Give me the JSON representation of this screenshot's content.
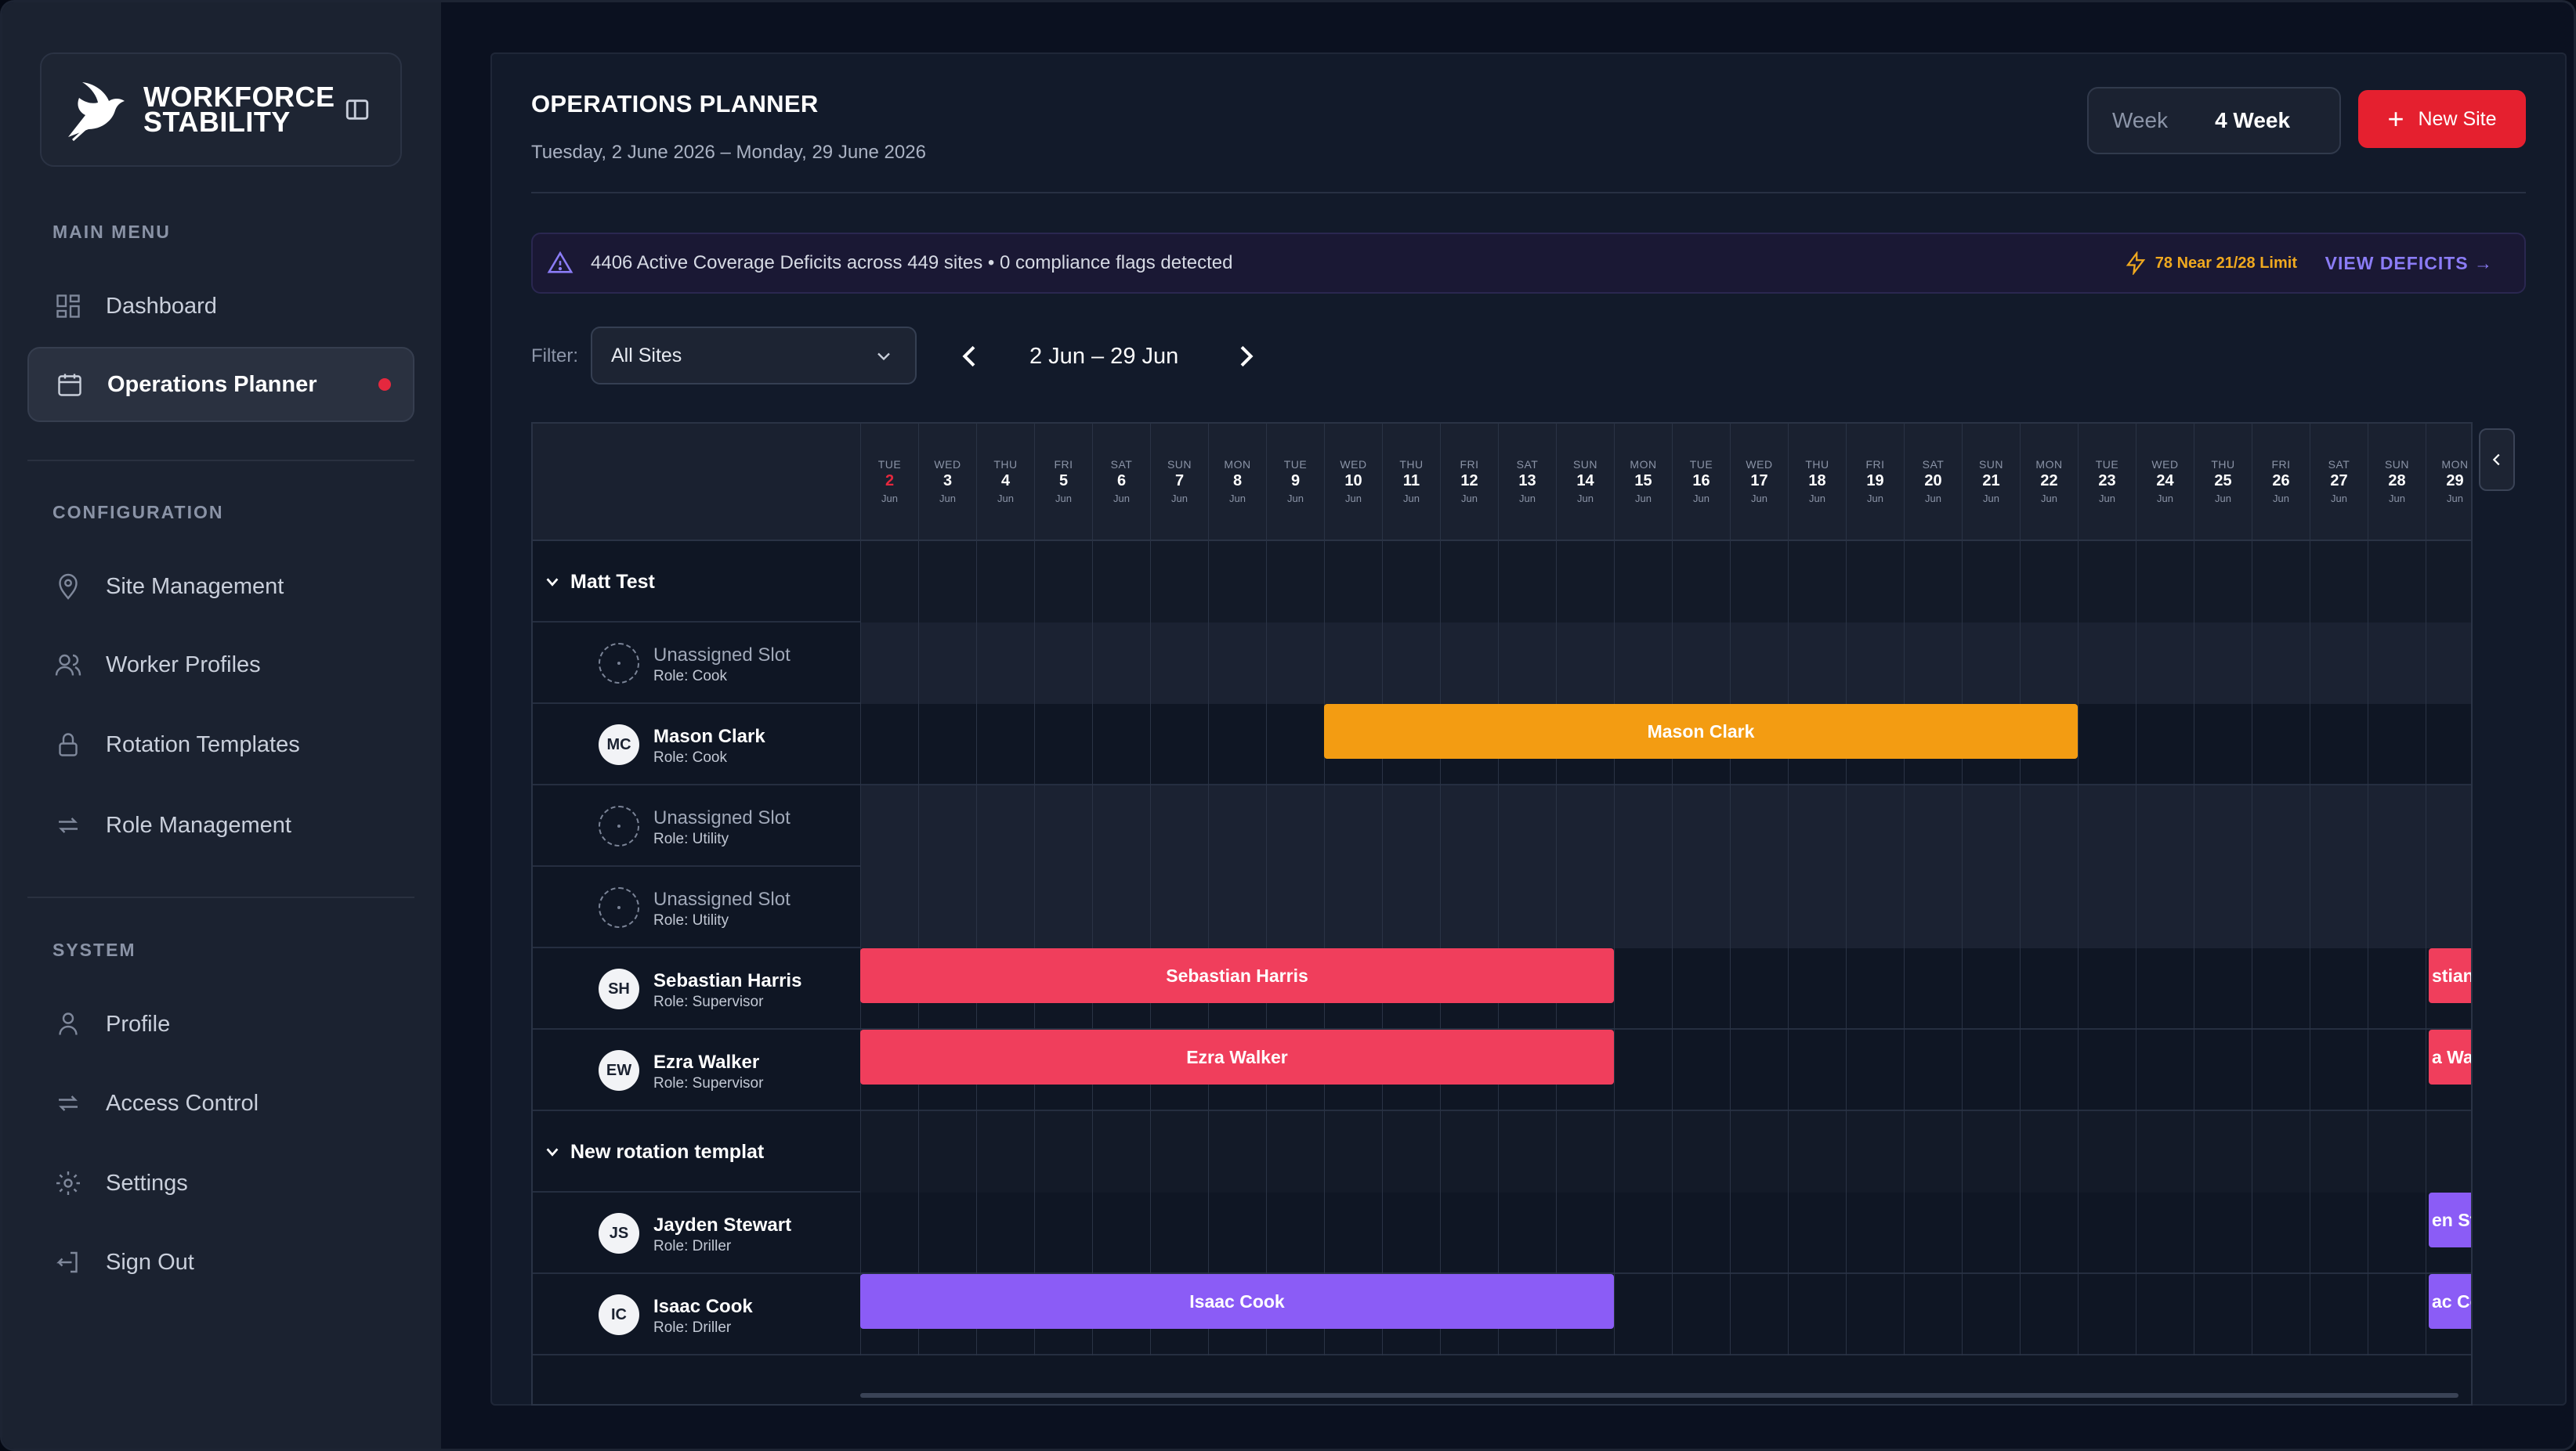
{
  "brand": {
    "name_line1": "WORKFORCE",
    "name_line2": "STABILITY"
  },
  "sidebar": {
    "main_menu_title": "MAIN MENU",
    "config_title": "CONFIGURATION",
    "system_title": "SYSTEM",
    "items": [
      {
        "label": "Dashboard",
        "icon": "dashboard-icon"
      },
      {
        "label": "Operations Planner",
        "icon": "calendar-icon",
        "active": true
      },
      {
        "label": "Site Management",
        "icon": "location-pin-icon"
      },
      {
        "label": "Worker Profiles",
        "icon": "users-icon"
      },
      {
        "label": "Rotation Templates",
        "icon": "lock-icon"
      },
      {
        "label": "Role Management",
        "icon": "repeat-icon"
      },
      {
        "label": "Profile",
        "icon": "user-icon"
      },
      {
        "label": "Access Control",
        "icon": "repeat-icon"
      },
      {
        "label": "Settings",
        "icon": "gear-icon"
      },
      {
        "label": "Sign Out",
        "icon": "sign-out-icon"
      }
    ]
  },
  "header": {
    "title": "OPERATIONS PLANNER",
    "subtitle": "Tuesday, 2 June 2026 – Monday, 29 June 2026",
    "view_week": "Week",
    "view_4week": "4 Week",
    "new_site": "New Site"
  },
  "alert": {
    "message": "4406 Active Coverage Deficits across 449 sites • 0 compliance flags detected",
    "limit": "78 Near 21/28 Limit",
    "link": "VIEW DEFICITS →"
  },
  "filter": {
    "label": "Filter:",
    "value": "All Sites",
    "range": "2 Jun – 29 Jun"
  },
  "calendar": {
    "month": "Jun",
    "days": [
      {
        "dow": "TUE",
        "d": "2"
      },
      {
        "dow": "WED",
        "d": "3"
      },
      {
        "dow": "THU",
        "d": "4"
      },
      {
        "dow": "FRI",
        "d": "5"
      },
      {
        "dow": "SAT",
        "d": "6"
      },
      {
        "dow": "SUN",
        "d": "7"
      },
      {
        "dow": "MON",
        "d": "8"
      },
      {
        "dow": "TUE",
        "d": "9"
      },
      {
        "dow": "WED",
        "d": "10"
      },
      {
        "dow": "THU",
        "d": "11"
      },
      {
        "dow": "FRI",
        "d": "12"
      },
      {
        "dow": "SAT",
        "d": "13"
      },
      {
        "dow": "SUN",
        "d": "14"
      },
      {
        "dow": "MON",
        "d": "15"
      },
      {
        "dow": "TUE",
        "d": "16"
      },
      {
        "dow": "WED",
        "d": "17"
      },
      {
        "dow": "THU",
        "d": "18"
      },
      {
        "dow": "FRI",
        "d": "19"
      },
      {
        "dow": "SAT",
        "d": "20"
      },
      {
        "dow": "SUN",
        "d": "21"
      },
      {
        "dow": "MON",
        "d": "22"
      },
      {
        "dow": "TUE",
        "d": "23"
      },
      {
        "dow": "WED",
        "d": "24"
      },
      {
        "dow": "THU",
        "d": "25"
      },
      {
        "dow": "FRI",
        "d": "26"
      },
      {
        "dow": "SAT",
        "d": "27"
      },
      {
        "dow": "SUN",
        "d": "28"
      },
      {
        "dow": "MON",
        "d": "29"
      }
    ],
    "rows": [
      {
        "type": "group",
        "name": "Matt Test"
      },
      {
        "type": "unassigned",
        "name": "Unassigned Slot",
        "role": "Role: Cook"
      },
      {
        "type": "worker",
        "initials": "MC",
        "name": "Mason Clark",
        "role": "Role: Cook",
        "bars": [
          {
            "label": "Mason Clark",
            "start": 8,
            "end": 20,
            "color": "#f39c12"
          }
        ]
      },
      {
        "type": "unassigned",
        "name": "Unassigned Slot",
        "role": "Role: Utility"
      },
      {
        "type": "unassigned",
        "name": "Unassigned Slot",
        "role": "Role: Utility"
      },
      {
        "type": "worker",
        "initials": "SH",
        "name": "Sebastian Harris",
        "role": "Role: Supervisor",
        "bars": [
          {
            "label": "Sebastian Harris",
            "start": 0,
            "end": 12,
            "color": "#f03e5c"
          },
          {
            "label": "stian H",
            "start": 27,
            "end": 27,
            "color": "#f03e5c",
            "clip": true
          }
        ]
      },
      {
        "type": "worker",
        "initials": "EW",
        "name": "Ezra Walker",
        "role": "Role: Supervisor",
        "bars": [
          {
            "label": "Ezra Walker",
            "start": 0,
            "end": 12,
            "color": "#f03e5c"
          },
          {
            "label": "a Wal",
            "start": 27,
            "end": 27,
            "color": "#f03e5c",
            "clip": true
          }
        ]
      },
      {
        "type": "group",
        "name": "New rotation templat"
      },
      {
        "type": "worker",
        "initials": "JS",
        "name": "Jayden Stewart",
        "role": "Role: Driller",
        "bars": [
          {
            "label": "en Ste",
            "start": 27,
            "end": 27,
            "color": "#8b5cf6",
            "clip": true
          }
        ]
      },
      {
        "type": "worker",
        "initials": "IC",
        "name": "Isaac Cook",
        "role": "Role: Driller",
        "bars": [
          {
            "label": "Isaac Cook",
            "start": 0,
            "end": 12,
            "color": "#8b5cf6"
          },
          {
            "label": "ac Co",
            "start": 27,
            "end": 27,
            "color": "#8b5cf6",
            "clip": true
          }
        ]
      }
    ]
  }
}
